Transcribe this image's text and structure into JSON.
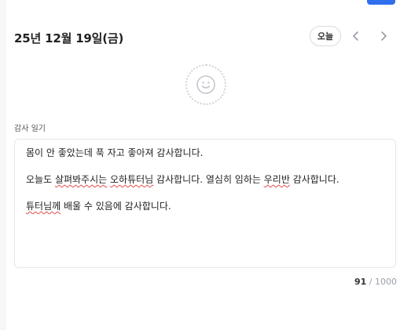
{
  "header": {
    "date_title": "25년 12월 19일(금)",
    "today_label": "오늘",
    "prev_icon": "chevron-left-icon",
    "next_icon": "chevron-right-icon"
  },
  "mood": {
    "icon": "smiley-face-icon"
  },
  "journal": {
    "label": "감사 일기",
    "line1": "몸이 안 좋았는데 푹 자고 좋아져 감사합니다.",
    "line2_a": "오늘도 ",
    "line2_b": "살펴봐주시는",
    "line2_c": " ",
    "line2_d": "오하튜터님",
    "line2_e": " 감사합니다. 열심히 임하는 ",
    "line2_f": "우리반",
    "line2_g": " 감사합니다.",
    "line3_a": "튜터님께",
    "line3_b": " 배울 수 있음에 감사합니다."
  },
  "counter": {
    "count": "91",
    "separator": " / ",
    "max": "1000"
  },
  "colors": {
    "accent": "#2f6fed",
    "spellcheck": "#e24a4a"
  }
}
